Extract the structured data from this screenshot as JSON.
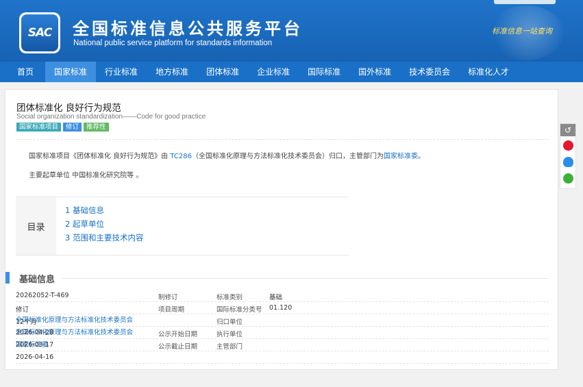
{
  "header": {
    "logo_text": "SAC",
    "title": "全国标准信息公共服务平台",
    "subtitle": "National public service platform  for standards information",
    "slogan": "标准信息一站查询"
  },
  "nav": {
    "items": [
      "首页",
      "国家标准",
      "行业标准",
      "地方标准",
      "团体标准",
      "企业标准",
      "国际标准",
      "国外标准",
      "技术委员会",
      "标准化人才"
    ],
    "active_index": 1
  },
  "standard": {
    "title_zh": "团体标准化 良好行为规范",
    "title_en": "Social organization standardization——Code for good practice",
    "tags": [
      "国家标准项目",
      "修订",
      "推荐性"
    ]
  },
  "description": {
    "prefix": "国家标准项目《团体标准化 良好行为规范》由 ",
    "tc_code": "TC286",
    "middle": "（全国标准化原理与方法标准化技术委员会）归口，主管部门为",
    "authority": "国家标准委",
    "suffix": "。",
    "drafter": "主要起草单位 中国标准化研究院等 。"
  },
  "toc": {
    "label": "目录",
    "items": [
      "1  基础信息",
      "2  起草单位",
      "3  范围和主要技术内容"
    ]
  },
  "basic_info": {
    "section_title": "基础信息",
    "rows": [
      {
        "c1": "20262052-T-469",
        "c2": "制修订",
        "c3": "标准类别",
        "c4": "基础",
        "link": false
      },
      {
        "c1": "修订",
        "c2": "项目周期",
        "c3": "国际标准分类号",
        "c4": "01.120",
        "link": false
      },
      {
        "c1": "12个月",
        "c2": "",
        "c3": "归口单位",
        "c4": "全国标准化原理与方法标准化技术委员会",
        "link": true
      },
      {
        "c1": "2026-04-28",
        "c2": "公示开始日期",
        "c3": "执行单位",
        "c4": "全国标准化原理与方法标准化技术委员会",
        "link": true
      },
      {
        "c1": "2026-03-17",
        "c2": "公示截止日期",
        "c3": "主管部门",
        "c4": "国家标准委",
        "link": true
      },
      {
        "c1": "2026-04-16",
        "c2": "",
        "c3": "",
        "c4": "",
        "link": false
      }
    ]
  },
  "share": {
    "back_glyph": "↺",
    "icons": [
      "weibo-icon",
      "qq-icon",
      "wechat-icon"
    ]
  },
  "colors": {
    "header_blue": "#1a69bd",
    "nav_blue": "#1970c6",
    "nav_active": "#3d8fe0",
    "link": "#1970c6",
    "tag_project": "#3aa9b8",
    "tag_revise": "#3d8fe0",
    "tag_recommend": "#62b965"
  }
}
